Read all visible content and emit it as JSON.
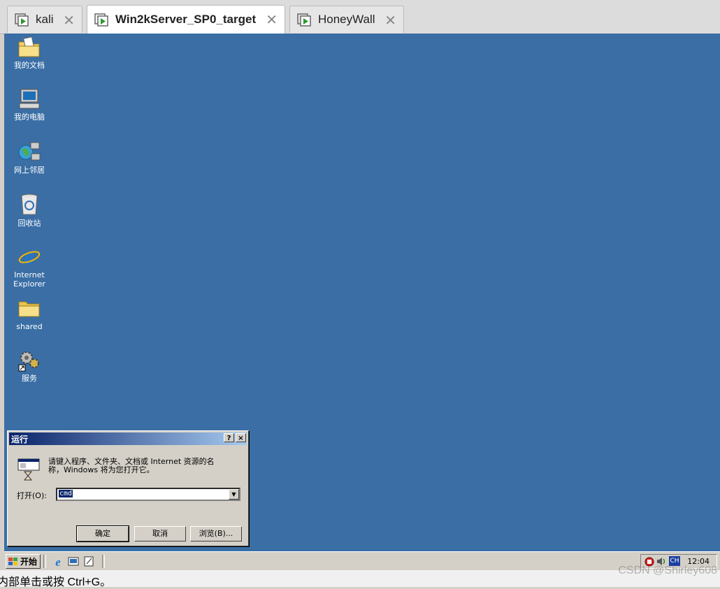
{
  "tabs": [
    {
      "label": "kali",
      "active": false
    },
    {
      "label": "Win2kServer_SP0_target",
      "active": true
    },
    {
      "label": "HoneyWall",
      "active": false
    }
  ],
  "desktop": {
    "background_color": "#3a6ea5",
    "icons": [
      {
        "label": "我的文档",
        "icon": "folder-docs-icon"
      },
      {
        "label": "我的电脑",
        "icon": "computer-icon"
      },
      {
        "label": "网上邻居",
        "icon": "network-icon"
      },
      {
        "label": "回收站",
        "icon": "recycle-bin-icon"
      },
      {
        "label_line1": "Internet",
        "label_line2": "Explorer",
        "icon": "ie-icon"
      },
      {
        "label": "shared",
        "icon": "folder-icon"
      },
      {
        "label": "服务",
        "icon": "services-icon"
      }
    ]
  },
  "run_dialog": {
    "title": "运行",
    "help_button": "?",
    "close_button": "×",
    "prompt_line1": "请键入程序、文件夹、文档或 Internet 资源的名",
    "prompt_line2": "称，Windows 将为您打开它。",
    "open_label": "打开(O):",
    "open_value": "cmd",
    "ok_button": "确定",
    "cancel_button": "取消",
    "browse_button": "浏览(B)..."
  },
  "taskbar": {
    "start_label": "开始",
    "ime_label": "CH",
    "clock": "12:04"
  },
  "status_bar": {
    "text": "内部单击或按 Ctrl+G。",
    "watermark": "CSDN @Shirley608"
  }
}
